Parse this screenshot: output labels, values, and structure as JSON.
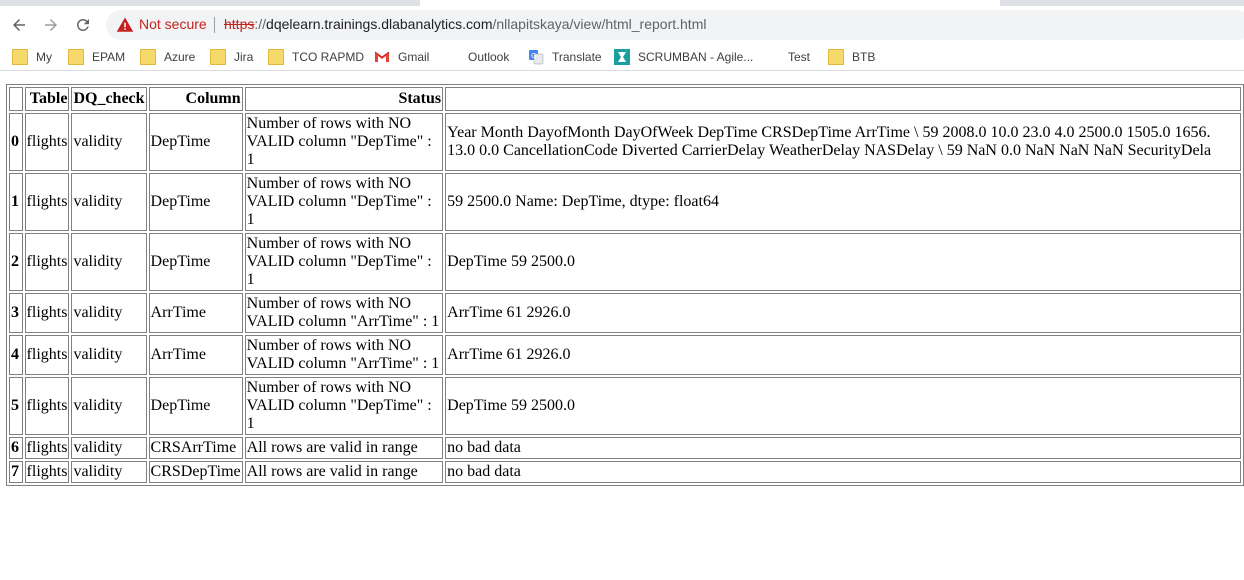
{
  "browser": {
    "security_label": "Not secure",
    "url_scheme": "https",
    "url_host": "dqelearn.trainings.dlabanalytics.com",
    "url_path": "/nllapitskaya/view/html_report.html"
  },
  "bookmarks": [
    {
      "label": "My",
      "icon": "folder-icon"
    },
    {
      "label": "EPAM",
      "icon": "folder-icon"
    },
    {
      "label": "Azure",
      "icon": "folder-icon"
    },
    {
      "label": "Jira",
      "icon": "folder-icon"
    },
    {
      "label": "TCO RAPMD",
      "icon": "folder-icon"
    },
    {
      "label": "Gmail",
      "icon": "gmail-icon"
    },
    {
      "label": "Outlook",
      "icon": "microsoft-icon"
    },
    {
      "label": "Translate",
      "icon": "translate-icon"
    },
    {
      "label": "SCRUMBAN - Agile...",
      "icon": "scrumban-icon"
    },
    {
      "label": "Test",
      "icon": "microsoft-icon"
    },
    {
      "label": "BTB",
      "icon": "folder-icon"
    }
  ],
  "report": {
    "columns": [
      "",
      "Table",
      "DQ_check",
      "Column",
      "Status",
      ""
    ],
    "rows": [
      {
        "index": "0",
        "table": "flights",
        "dq_check": "validity",
        "column": "DepTime",
        "status": "Number of rows with NO VALID column \"DepTime\" : 1",
        "data_line1": "Year Month DayofMonth DayOfWeek DepTime CRSDepTime ArrTime \\ 59 2008.0 10.0 23.0 4.0 2500.0 1505.0 1656.",
        "data_line2": "13.0 0.0 CancellationCode Diverted CarrierDelay WeatherDelay NASDelay \\ 59 NaN 0.0 NaN NaN NaN SecurityDela"
      },
      {
        "index": "1",
        "table": "flights",
        "dq_check": "validity",
        "column": "DepTime",
        "status": "Number of rows with NO VALID column \"DepTime\" : 1",
        "data_line1": "59 2500.0 Name: DepTime, dtype: float64",
        "data_line2": ""
      },
      {
        "index": "2",
        "table": "flights",
        "dq_check": "validity",
        "column": "DepTime",
        "status": "Number of rows with NO VALID column \"DepTime\" : 1",
        "data_line1": "DepTime 59 2500.0",
        "data_line2": ""
      },
      {
        "index": "3",
        "table": "flights",
        "dq_check": "validity",
        "column": "ArrTime",
        "status": "Number of rows with NO VALID column \"ArrTime\" : 1",
        "data_line1": "ArrTime 61 2926.0",
        "data_line2": ""
      },
      {
        "index": "4",
        "table": "flights",
        "dq_check": "validity",
        "column": "ArrTime",
        "status": "Number of rows with NO VALID column \"ArrTime\" : 1",
        "data_line1": "ArrTime 61 2926.0",
        "data_line2": ""
      },
      {
        "index": "5",
        "table": "flights",
        "dq_check": "validity",
        "column": "DepTime",
        "status": "Number of rows with NO VALID column \"DepTime\" : 1",
        "data_line1": "DepTime 59 2500.0",
        "data_line2": ""
      },
      {
        "index": "6",
        "table": "flights",
        "dq_check": "validity",
        "column": "CRSArrTime",
        "status": "All rows are valid in range",
        "data_line1": "no bad data",
        "data_line2": ""
      },
      {
        "index": "7",
        "table": "flights",
        "dq_check": "validity",
        "column": "CRSDepTime",
        "status": "All rows are valid in range",
        "data_line1": "no bad data",
        "data_line2": ""
      }
    ]
  }
}
